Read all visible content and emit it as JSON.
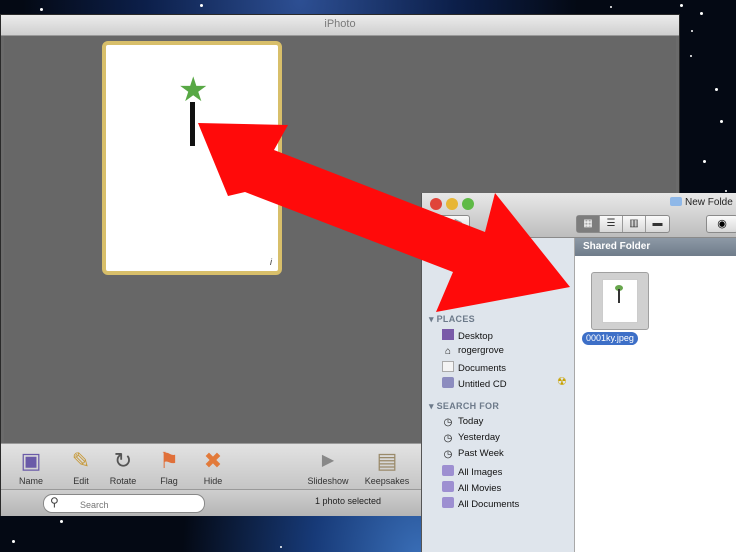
{
  "iphoto": {
    "title": "iPhoto",
    "toolbar": [
      {
        "label": "Name",
        "icon": "name-icon",
        "glyph": "▣"
      },
      {
        "label": "Edit",
        "icon": "pencil-icon",
        "glyph": "✎"
      },
      {
        "label": "Rotate",
        "icon": "rotate-icon",
        "glyph": "↻"
      },
      {
        "label": "Flag",
        "icon": "flag-icon",
        "glyph": "⚑"
      },
      {
        "label": "Hide",
        "icon": "hide-icon",
        "glyph": "✖"
      },
      {
        "label": "Slideshow",
        "icon": "play-icon",
        "glyph": "▶"
      },
      {
        "label": "Keepsakes",
        "icon": "keepsakes-icon",
        "glyph": "▤"
      }
    ],
    "search_placeholder": "Search",
    "status": "1 photo selected",
    "photo_info_glyph": "i"
  },
  "finder": {
    "title": "New Folde",
    "path": "Shared Folder",
    "sections": [
      {
        "label": "PLACES",
        "items": [
          {
            "label": "Desktop",
            "icon": "desktop-icon"
          },
          {
            "label": "rogergrove",
            "icon": "home-icon"
          },
          {
            "label": "Documents",
            "icon": "documents-icon"
          },
          {
            "label": "Untitled CD",
            "icon": "cd-icon"
          }
        ]
      },
      {
        "label": "SEARCH FOR",
        "items": [
          {
            "label": "Today",
            "icon": "clock-icon"
          },
          {
            "label": "Yesterday",
            "icon": "clock-icon"
          },
          {
            "label": "Past Week",
            "icon": "clock-icon"
          },
          {
            "label": "All Images",
            "icon": "smart-folder-icon"
          },
          {
            "label": "All Movies",
            "icon": "smart-folder-icon"
          },
          {
            "label": "All Documents",
            "icon": "smart-folder-icon"
          }
        ]
      }
    ],
    "file": {
      "name": "0001ky.jpeg"
    }
  },
  "colors": {
    "arrow": "#ff0a0a",
    "selection": "#3d6fc7",
    "photo_border": "#d8bf6a"
  }
}
